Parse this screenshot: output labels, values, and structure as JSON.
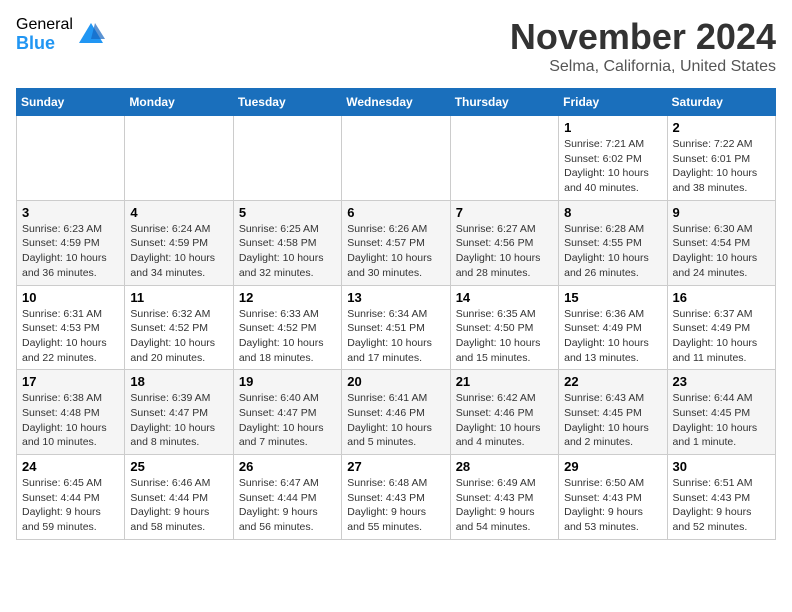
{
  "logo": {
    "general": "General",
    "blue": "Blue"
  },
  "title": "November 2024",
  "location": "Selma, California, United States",
  "days_of_week": [
    "Sunday",
    "Monday",
    "Tuesday",
    "Wednesday",
    "Thursday",
    "Friday",
    "Saturday"
  ],
  "weeks": [
    [
      {
        "day": "",
        "info": ""
      },
      {
        "day": "",
        "info": ""
      },
      {
        "day": "",
        "info": ""
      },
      {
        "day": "",
        "info": ""
      },
      {
        "day": "",
        "info": ""
      },
      {
        "day": "1",
        "info": "Sunrise: 7:21 AM\nSunset: 6:02 PM\nDaylight: 10 hours and 40 minutes."
      },
      {
        "day": "2",
        "info": "Sunrise: 7:22 AM\nSunset: 6:01 PM\nDaylight: 10 hours and 38 minutes."
      }
    ],
    [
      {
        "day": "3",
        "info": "Sunrise: 6:23 AM\nSunset: 4:59 PM\nDaylight: 10 hours and 36 minutes."
      },
      {
        "day": "4",
        "info": "Sunrise: 6:24 AM\nSunset: 4:59 PM\nDaylight: 10 hours and 34 minutes."
      },
      {
        "day": "5",
        "info": "Sunrise: 6:25 AM\nSunset: 4:58 PM\nDaylight: 10 hours and 32 minutes."
      },
      {
        "day": "6",
        "info": "Sunrise: 6:26 AM\nSunset: 4:57 PM\nDaylight: 10 hours and 30 minutes."
      },
      {
        "day": "7",
        "info": "Sunrise: 6:27 AM\nSunset: 4:56 PM\nDaylight: 10 hours and 28 minutes."
      },
      {
        "day": "8",
        "info": "Sunrise: 6:28 AM\nSunset: 4:55 PM\nDaylight: 10 hours and 26 minutes."
      },
      {
        "day": "9",
        "info": "Sunrise: 6:30 AM\nSunset: 4:54 PM\nDaylight: 10 hours and 24 minutes."
      }
    ],
    [
      {
        "day": "10",
        "info": "Sunrise: 6:31 AM\nSunset: 4:53 PM\nDaylight: 10 hours and 22 minutes."
      },
      {
        "day": "11",
        "info": "Sunrise: 6:32 AM\nSunset: 4:52 PM\nDaylight: 10 hours and 20 minutes."
      },
      {
        "day": "12",
        "info": "Sunrise: 6:33 AM\nSunset: 4:52 PM\nDaylight: 10 hours and 18 minutes."
      },
      {
        "day": "13",
        "info": "Sunrise: 6:34 AM\nSunset: 4:51 PM\nDaylight: 10 hours and 17 minutes."
      },
      {
        "day": "14",
        "info": "Sunrise: 6:35 AM\nSunset: 4:50 PM\nDaylight: 10 hours and 15 minutes."
      },
      {
        "day": "15",
        "info": "Sunrise: 6:36 AM\nSunset: 4:49 PM\nDaylight: 10 hours and 13 minutes."
      },
      {
        "day": "16",
        "info": "Sunrise: 6:37 AM\nSunset: 4:49 PM\nDaylight: 10 hours and 11 minutes."
      }
    ],
    [
      {
        "day": "17",
        "info": "Sunrise: 6:38 AM\nSunset: 4:48 PM\nDaylight: 10 hours and 10 minutes."
      },
      {
        "day": "18",
        "info": "Sunrise: 6:39 AM\nSunset: 4:47 PM\nDaylight: 10 hours and 8 minutes."
      },
      {
        "day": "19",
        "info": "Sunrise: 6:40 AM\nSunset: 4:47 PM\nDaylight: 10 hours and 7 minutes."
      },
      {
        "day": "20",
        "info": "Sunrise: 6:41 AM\nSunset: 4:46 PM\nDaylight: 10 hours and 5 minutes."
      },
      {
        "day": "21",
        "info": "Sunrise: 6:42 AM\nSunset: 4:46 PM\nDaylight: 10 hours and 4 minutes."
      },
      {
        "day": "22",
        "info": "Sunrise: 6:43 AM\nSunset: 4:45 PM\nDaylight: 10 hours and 2 minutes."
      },
      {
        "day": "23",
        "info": "Sunrise: 6:44 AM\nSunset: 4:45 PM\nDaylight: 10 hours and 1 minute."
      }
    ],
    [
      {
        "day": "24",
        "info": "Sunrise: 6:45 AM\nSunset: 4:44 PM\nDaylight: 9 hours and 59 minutes."
      },
      {
        "day": "25",
        "info": "Sunrise: 6:46 AM\nSunset: 4:44 PM\nDaylight: 9 hours and 58 minutes."
      },
      {
        "day": "26",
        "info": "Sunrise: 6:47 AM\nSunset: 4:44 PM\nDaylight: 9 hours and 56 minutes."
      },
      {
        "day": "27",
        "info": "Sunrise: 6:48 AM\nSunset: 4:43 PM\nDaylight: 9 hours and 55 minutes."
      },
      {
        "day": "28",
        "info": "Sunrise: 6:49 AM\nSunset: 4:43 PM\nDaylight: 9 hours and 54 minutes."
      },
      {
        "day": "29",
        "info": "Sunrise: 6:50 AM\nSunset: 4:43 PM\nDaylight: 9 hours and 53 minutes."
      },
      {
        "day": "30",
        "info": "Sunrise: 6:51 AM\nSunset: 4:43 PM\nDaylight: 9 hours and 52 minutes."
      }
    ]
  ]
}
